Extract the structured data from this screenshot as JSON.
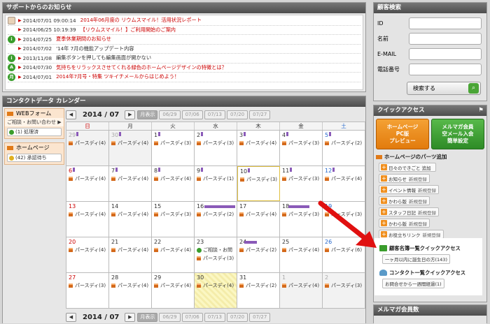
{
  "announcements": {
    "title": "サポートからのお知らせ",
    "items": [
      {
        "icon": "image",
        "date": "2014/07/01 09:00:14",
        "text": "2014年06月度の リウムスマイル！活用状況レポート",
        "red": true
      },
      {
        "icon": "none",
        "date": "2014/06/25 10:19:39",
        "text": "【リウムスマイル！】ご利用開始のご案内",
        "red": true
      },
      {
        "icon": "i",
        "date": "2014/07/25",
        "text": "夏季休業期間のお知らせ",
        "red": true
      },
      {
        "icon": "none",
        "date": "2014/07/02",
        "text": "'14年 7月の機能アップデート内容",
        "red": false
      },
      {
        "icon": "i",
        "date": "2013/11/08",
        "text": "編集ボタンを押しても編集画面が開かない",
        "red": false
      },
      {
        "icon": "A",
        "date": "2014/07/30",
        "text": "気持ちをリラックスさせてくれる緑色のホームページデザインの特徴とは？",
        "red": true
      },
      {
        "icon": "月",
        "date": "2014/07/01",
        "text": "2014年7月号・特集 ツキイチメールからはじめよう！",
        "red": true
      }
    ]
  },
  "customer_search": {
    "title": "顧客検索",
    "fields": [
      {
        "label": "ID",
        "value": ""
      },
      {
        "label": "名前",
        "value": ""
      },
      {
        "label": "E-MAIL",
        "value": ""
      },
      {
        "label": "電話番号",
        "value": ""
      }
    ],
    "search_button": "検索する"
  },
  "calendar": {
    "title": "コンタクトデータ カレンダー",
    "month": "2014 / 07",
    "view_month": "月表示",
    "weeks": [
      "06/29",
      "07/06",
      "07/13",
      "07/20",
      "07/27"
    ],
    "weekdays": [
      "日",
      "月",
      "火",
      "水",
      "木",
      "金",
      "土"
    ],
    "sidebar": {
      "web_form": "WEBフォーム",
      "web_form_item": "ご相談・お問い合わせ",
      "web_form_count": "(1) 処理済",
      "homepage": "ホームページ",
      "homepage_count": "(42) 承認待ち"
    },
    "rows": [
      [
        {
          "d": "29",
          "cls": "gray",
          "ev": "パースディ(4)"
        },
        {
          "d": "30",
          "cls": "gray",
          "ev": "パースディ(4)"
        },
        {
          "d": "1",
          "ev": "パースディ(3)"
        },
        {
          "d": "2",
          "ev": "パースディ(3)"
        },
        {
          "d": "3",
          "ev": "パースディ(4)"
        },
        {
          "d": "4",
          "ev": "パースディ(3)"
        },
        {
          "d": "5",
          "ev": "パースディ(2)"
        }
      ],
      [
        {
          "d": "6",
          "ev": "パースディ(4)"
        },
        {
          "d": "7",
          "ev": "パースディ(4)"
        },
        {
          "d": "8",
          "ev": "パースディ(4)"
        },
        {
          "d": "9",
          "ev": "パースディ(1)"
        },
        {
          "d": "10",
          "ev": "パースディ(3)"
        },
        {
          "d": "11",
          "ev": "パースディ(3)"
        },
        {
          "d": "12",
          "ev": "パースディ(4)"
        }
      ],
      [
        {
          "d": "13",
          "ev": "パースディ(4)"
        },
        {
          "d": "14",
          "ev": "パースディ(4)"
        },
        {
          "d": "15",
          "ev": "パースディ(3)"
        },
        {
          "d": "16",
          "ev": "パースディ(2)"
        },
        {
          "d": "17",
          "ev": "パースディ(4)"
        },
        {
          "d": "18",
          "ev": "パースディ(3)"
        },
        {
          "d": "19",
          "ev": "パースディ(3)"
        }
      ],
      [
        {
          "d": "20",
          "ev": "パースディ(4)"
        },
        {
          "d": "21",
          "ev": "パースディ(4)"
        },
        {
          "d": "22",
          "ev": "パースディ(4)"
        },
        {
          "d": "23",
          "ev": "パースディ(3)",
          "extra": "ご相談・お問"
        },
        {
          "d": "24",
          "ev": "パースディ(2)"
        },
        {
          "d": "25",
          "ev": "パースディ(4)"
        },
        {
          "d": "26",
          "ev": "パースディ(6)"
        }
      ],
      [
        {
          "d": "27",
          "ev": "パースディ(3)"
        },
        {
          "d": "28",
          "ev": "パースディ(4)"
        },
        {
          "d": "29",
          "ev": "パースディ(4)"
        },
        {
          "d": "30",
          "ev": "パースディ(4)"
        },
        {
          "d": "31",
          "ev": "パースディ(2)"
        },
        {
          "d": "1",
          "cls": "gray",
          "ev": "パースディ(4)"
        },
        {
          "d": "2",
          "cls": "gray",
          "ev": "パースディ(3)"
        }
      ]
    ]
  },
  "quick_access": {
    "title": "クイックアクセス",
    "btn_preview": "ホームページ\nPC版\nプレビュー",
    "btn_mail": "メルマガ会員\n空メール入会\n簡単設定",
    "parts_heading": "ホームページのパーツ追加",
    "parts": [
      {
        "label": "日々のできごと 追加",
        "note": ""
      },
      {
        "label": "お知らせ",
        "note": "新規登録"
      },
      {
        "label": "イベント情報",
        "note": "新規登録"
      },
      {
        "label": "かわら版",
        "note": "新規登録"
      },
      {
        "label": "スタッフ日記",
        "note": "新規登録"
      },
      {
        "label": "かわら版",
        "note": "新規登録"
      },
      {
        "label": "お役立ちリンク",
        "note": "新規登録"
      }
    ],
    "customer_list": "顧客名簿一覧クイックアクセス",
    "customer_link": "一ヶ月以内に誕生日の方(143)",
    "contact_list": "コンタクト一覧クイックアクセス",
    "contact_link": "お問合せから一週間経過(1)"
  },
  "mail_members": {
    "title": "メルマガ会員数"
  },
  "colors": {
    "accent_red": "#cc0000",
    "orange": "#e07a18",
    "green": "#3a9d2c",
    "purple": "#8a5ab8"
  }
}
